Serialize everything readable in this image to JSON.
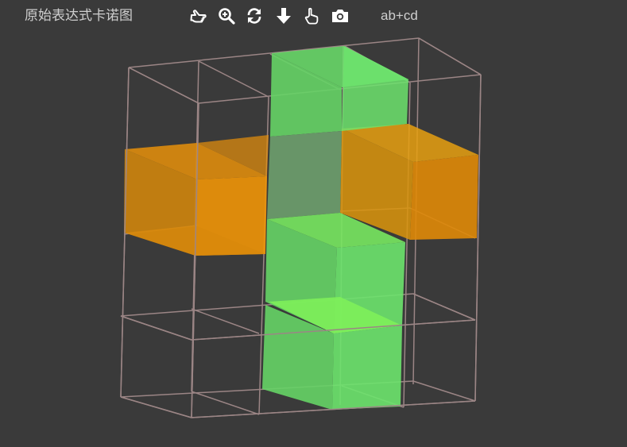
{
  "toolbar": {
    "title": "原始表达式卡诺图",
    "expression": "ab+cd",
    "tools": [
      {
        "name": "pointer-icon"
      },
      {
        "name": "zoom-icon"
      },
      {
        "name": "refresh-icon"
      },
      {
        "name": "download-icon"
      },
      {
        "name": "hand-icon"
      },
      {
        "name": "camera-icon"
      }
    ]
  },
  "colors": {
    "background": "#3a3a3a",
    "wireframe": "#9b8585",
    "orange": "#f0950a",
    "green": "#6ee36e",
    "text": "#cfcfcf"
  }
}
